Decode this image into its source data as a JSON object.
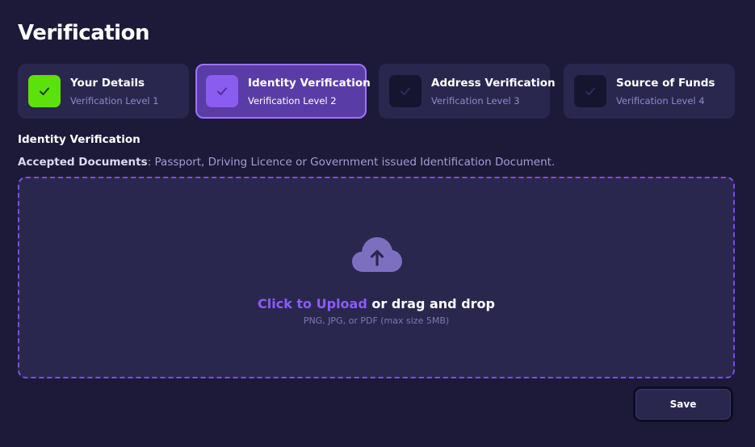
{
  "page": {
    "title": "Verification"
  },
  "steps": [
    {
      "title": "Your Details",
      "subtitle": "Verification Level 1",
      "state": "done"
    },
    {
      "title": "Identity Verification",
      "subtitle": "Verification Level 2",
      "state": "current"
    },
    {
      "title": "Address Verification",
      "subtitle": "Verification Level 3",
      "state": "pending"
    },
    {
      "title": "Source of Funds",
      "subtitle": "Verification Level 4",
      "state": "pending"
    }
  ],
  "section": {
    "title": "Identity Verification",
    "accepted_label": "Accepted Documents",
    "accepted_value": ": Passport, Driving Licence or Government issued Identification Document."
  },
  "upload": {
    "link_text": "Click to Upload",
    "rest_text": " or drag and drop",
    "hint": "PNG, JPG, or PDF (max size 5MB)",
    "icon": "cloud-upload-icon"
  },
  "actions": {
    "save_label": "Save"
  },
  "colors": {
    "background": "#1c1a38",
    "card": "#2a274f",
    "accent": "#8b5cf6",
    "success": "#5be10c"
  }
}
